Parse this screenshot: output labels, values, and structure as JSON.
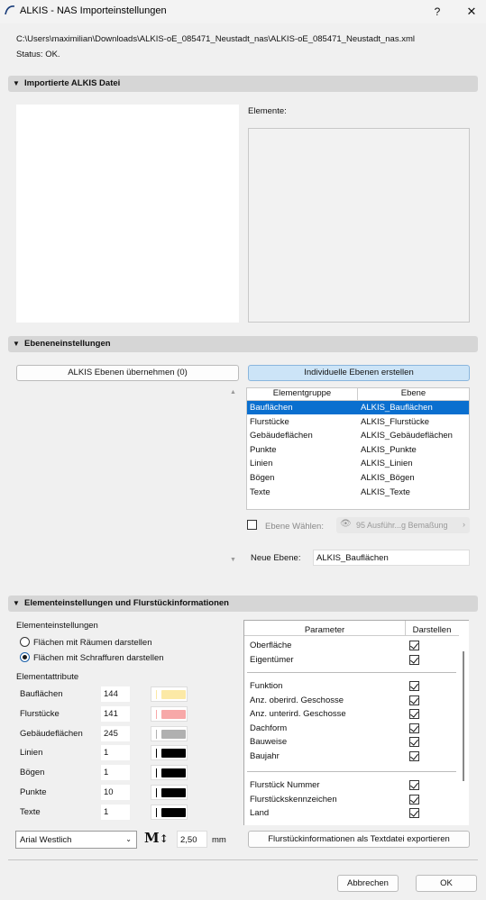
{
  "window": {
    "title": "ALKIS - NAS Importeinstellungen",
    "help_label": "?",
    "close_label": "✕"
  },
  "file": {
    "path": "C:\\Users\\maximilian\\Downloads\\ALKIS-oE_085471_Neustadt_nas\\ALKIS-oE_085471_Neustadt_nas.xml",
    "status": "Status: OK."
  },
  "sections": {
    "imported": "Importierte ALKIS Datei",
    "layers": "Ebeneneinstellungen",
    "elements": "Elementeinstellungen und Flurstückinformationen"
  },
  "imported": {
    "elements_label": "Elemente:"
  },
  "layers": {
    "take_over_button": "ALKIS Ebenen übernehmen (0)",
    "create_button": "Individuelle Ebenen erstellen",
    "table_headers": [
      "Elementgruppe",
      "Ebene"
    ],
    "rows": [
      {
        "group": "Bauflächen",
        "layer": "ALKIS_Bauflächen",
        "selected": true
      },
      {
        "group": "Flurstücke",
        "layer": "ALKIS_Flurstücke",
        "selected": false
      },
      {
        "group": "Gebäudeflächen",
        "layer": "ALKIS_Gebäudeflächen",
        "selected": false
      },
      {
        "group": "Punkte",
        "layer": "ALKIS_Punkte",
        "selected": false
      },
      {
        "group": "Linien",
        "layer": "ALKIS_Linien",
        "selected": false
      },
      {
        "group": "Bögen",
        "layer": "ALKIS_Bögen",
        "selected": false
      },
      {
        "group": "Texte",
        "layer": "ALKIS_Texte",
        "selected": false
      }
    ],
    "choose_layer_label": "Ebene Wählen:",
    "choose_layer_value": "95 Ausführ...g Bemaßung",
    "new_layer_label": "Neue Ebene:",
    "new_layer_value": "ALKIS_Bauflächen"
  },
  "elements": {
    "settings_heading": "Elementeinstellungen",
    "radio_rooms": "Flächen mit Räumen darstellen",
    "radio_hatch": "Flächen mit Schraffuren darstellen",
    "attributes_heading": "Elementattribute",
    "attributes": [
      {
        "name": "Bauflächen",
        "value": "144",
        "color": "#fce9a6"
      },
      {
        "name": "Flurstücke",
        "value": "141",
        "color": "#f7a8a8"
      },
      {
        "name": "Gebäudeflächen",
        "value": "245",
        "color": "#b0b0b0"
      },
      {
        "name": "Linien",
        "value": "1",
        "color": "#000000"
      },
      {
        "name": "Bögen",
        "value": "1",
        "color": "#000000"
      },
      {
        "name": "Punkte",
        "value": "10",
        "color": "#000000"
      },
      {
        "name": "Texte",
        "value": "1",
        "color": "#000000"
      }
    ],
    "font_value": "Arial Westlich",
    "size_value": "2,50",
    "size_unit": "mm",
    "param_headers": [
      "Parameter",
      "Darstellen"
    ],
    "params_group1": [
      "Oberfläche",
      "Eigentümer"
    ],
    "params_group2": [
      "Funktion",
      "Anz. oberird. Geschosse",
      "Anz. unterird. Geschosse",
      "Dachform",
      "Bauweise",
      "Baujahr"
    ],
    "params_group3": [
      "Flurstück Nummer",
      "Flurstückskennzeichen",
      "Land"
    ],
    "export_button": "Flurstückinformationen als Textdatei exportieren"
  },
  "footer": {
    "cancel": "Abbrechen",
    "ok": "OK"
  }
}
